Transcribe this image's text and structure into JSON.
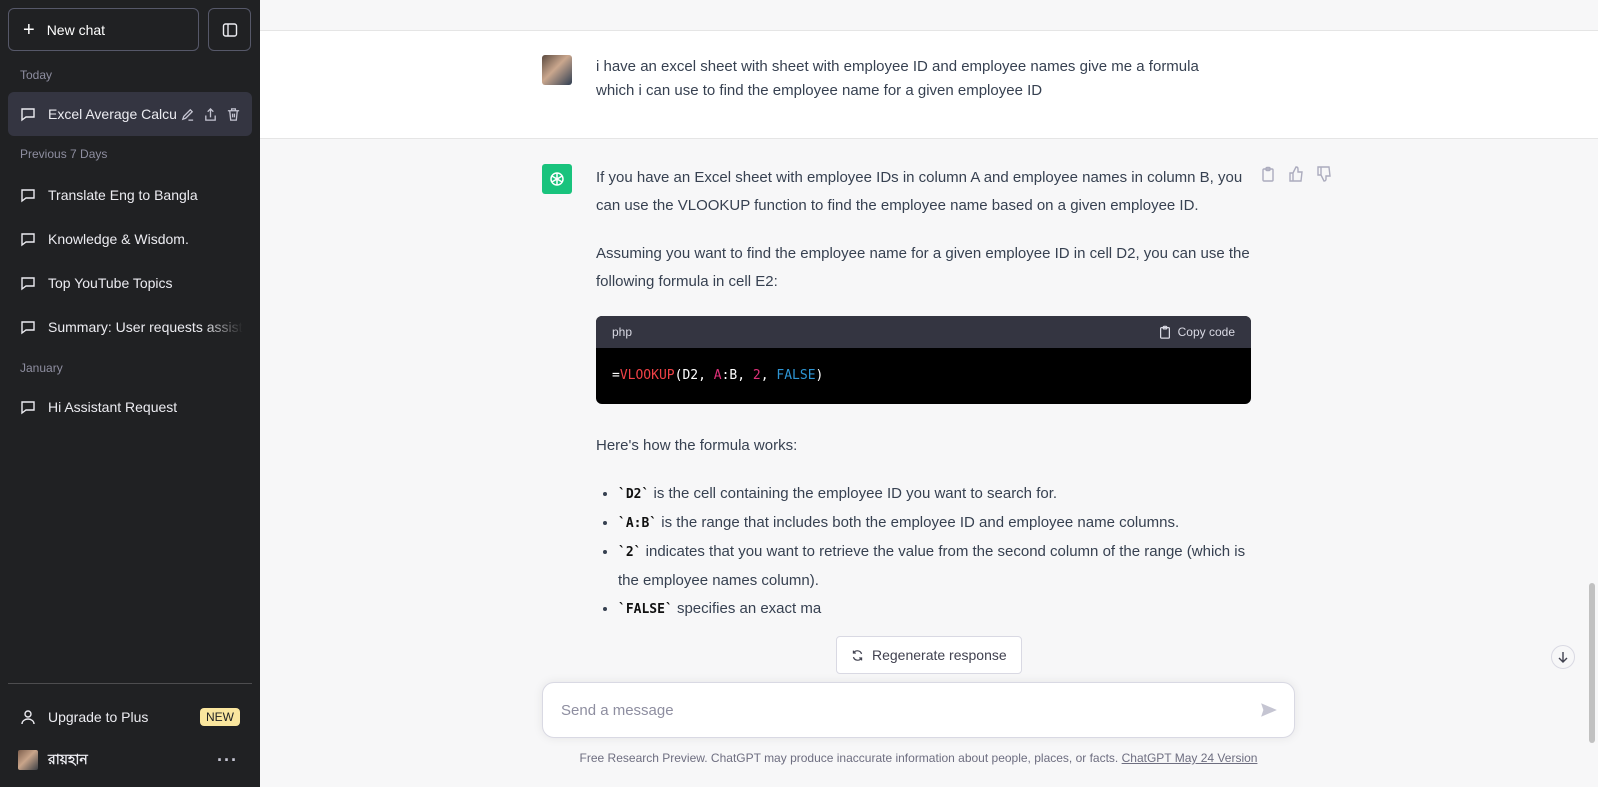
{
  "sidebar": {
    "new_chat_label": "New chat",
    "sections": [
      {
        "label": "Today"
      },
      {
        "label": "Previous 7 Days"
      },
      {
        "label": "January"
      }
    ],
    "chats": [
      {
        "label": "Excel Average Calcul"
      },
      {
        "label": "Translate Eng to Bangla"
      },
      {
        "label": "Knowledge & Wisdom."
      },
      {
        "label": "Top YouTube Topics"
      },
      {
        "label": "Summary: User requests assist"
      },
      {
        "label": "Hi Assistant Request"
      }
    ],
    "upgrade_label": "Upgrade to Plus",
    "upgrade_badge": "NEW",
    "user_name": "রায়হান",
    "more_label": "···"
  },
  "conversation": {
    "user_message": "i have an excel sheet with sheet with employee ID and employee names give me a formula which i can use to find the employee name for a given employee ID",
    "assistant": {
      "para1": "If you have an Excel sheet with employee IDs in column A and employee names in column B, you can use the VLOOKUP function to find the employee name based on a given employee ID.",
      "para2": "Assuming you want to find the employee name for a given employee ID in cell D2, you can use the following formula in cell E2:",
      "code_lang": "php",
      "copy_label": "Copy code",
      "code": {
        "eq": "=",
        "fn": "VLOOKUP",
        "open": "(D2, ",
        "ref": "A",
        "mid": ":B, ",
        "num": "2",
        "sep": ", ",
        "kw": "FALSE",
        "close": ")"
      },
      "para3": "Here's how the formula works:",
      "bullets": [
        {
          "code": "`D2`",
          "text": " is the cell containing the employee ID you want to search for."
        },
        {
          "code": "`A:B`",
          "text": " is the range that includes both the employee ID and employee name columns."
        },
        {
          "code": "`2`",
          "text": " indicates that you want to retrieve the value from the second column of the range (which is the employee names column)."
        },
        {
          "code": "`FALSE`",
          "text": " specifies an exact ma"
        }
      ]
    }
  },
  "regenerate_label": "Regenerate response",
  "composer": {
    "placeholder": "Send a message"
  },
  "footer": {
    "text": "Free Research Preview. ChatGPT may produce inaccurate information about people, places, or facts. ",
    "link": "ChatGPT May 24 Version"
  },
  "colors": {
    "sidebar_bg": "#202123",
    "accent": "#19c37d",
    "badge": "#fae69e"
  }
}
